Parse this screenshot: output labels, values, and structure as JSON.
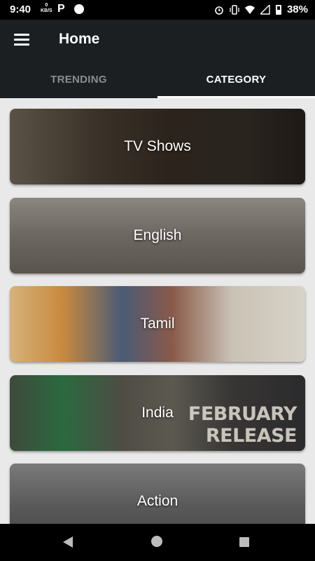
{
  "status_bar": {
    "time": "9:40",
    "net_speed_value": "0",
    "net_speed_unit": "KB/S",
    "app_letter": "P",
    "battery": "38%"
  },
  "app_bar": {
    "title": "Home",
    "tabs": [
      {
        "label": "TRENDING",
        "active": false
      },
      {
        "label": "CATEGORY",
        "active": true
      }
    ]
  },
  "categories": [
    {
      "label": "TV Shows"
    },
    {
      "label": "English"
    },
    {
      "label": "Tamil"
    },
    {
      "label": "India",
      "overlay_text_1": "FEBRUARY",
      "overlay_text_2": "RELEASE"
    },
    {
      "label": "Action"
    }
  ],
  "icons": {
    "menu": "hamburger-icon",
    "alarm": "alarm-icon",
    "vibrate": "vibrate-icon",
    "wifi": "wifi-icon",
    "signal": "signal-icon",
    "battery": "battery-icon",
    "back": "back-icon",
    "home": "home-icon",
    "recents": "recents-icon"
  },
  "colors": {
    "app_bar": "#1b1f22",
    "tab_active": "#ffffff",
    "tab_inactive": "#8a8d90",
    "background": "#e9e9e9"
  }
}
